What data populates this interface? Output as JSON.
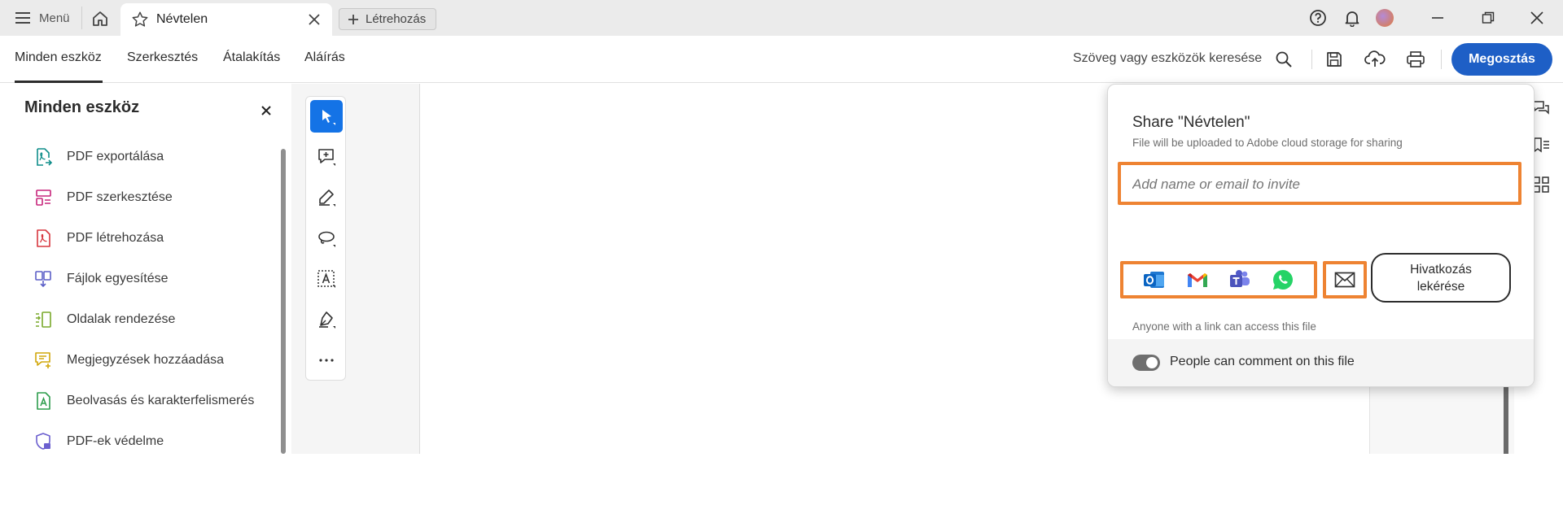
{
  "titlebar": {
    "menu_label": "Menü",
    "tab_title": "Névtelen",
    "new_tab_label": "Létrehozás"
  },
  "toolbar": {
    "tabs": [
      "Minden eszköz",
      "Szerkesztés",
      "Átalakítás",
      "Aláírás"
    ],
    "search_label": "Szöveg vagy eszközök keresése",
    "share_label": "Megosztás"
  },
  "left_panel": {
    "title": "Minden eszköz",
    "items": [
      {
        "label": "PDF exportálása",
        "icon": "pdf-export-icon",
        "color": "#0f8d8a"
      },
      {
        "label": "PDF szerkesztése",
        "icon": "pdf-edit-icon",
        "color": "#c7257b"
      },
      {
        "label": "PDF létrehozása",
        "icon": "pdf-create-icon",
        "color": "#d7373f"
      },
      {
        "label": "Fájlok egyesítése",
        "icon": "combine-files-icon",
        "color": "#5b5fc7"
      },
      {
        "label": "Oldalak rendezése",
        "icon": "organize-pages-icon",
        "color": "#7aa92b"
      },
      {
        "label": "Megjegyzések hozzáadása",
        "icon": "add-comment-icon",
        "color": "#d1a70b"
      },
      {
        "label": "Beolvasás és karakterfelismerés",
        "icon": "scan-ocr-icon",
        "color": "#2d9d4c"
      },
      {
        "label": "PDF-ek védelme",
        "icon": "protect-pdf-icon",
        "color": "#6b5fcf"
      }
    ]
  },
  "share_popover": {
    "title": "Share \"Névtelen\"",
    "subtitle": "File will be uploaded to Adobe cloud storage for sharing",
    "invite_placeholder": "Add name or email to invite",
    "apps": [
      "outlook-icon",
      "gmail-icon",
      "teams-icon",
      "whatsapp-icon"
    ],
    "link_button_line1": "Hivatkozás",
    "link_button_line2": "lekérése",
    "link_note": "Anyone with a link can access this file",
    "comment_toggle_label": "People can comment on this file",
    "highlight_color": "#ee8332"
  },
  "colors": {
    "accent": "#1e5fc6",
    "titlebar_bg": "#ebebeb"
  }
}
